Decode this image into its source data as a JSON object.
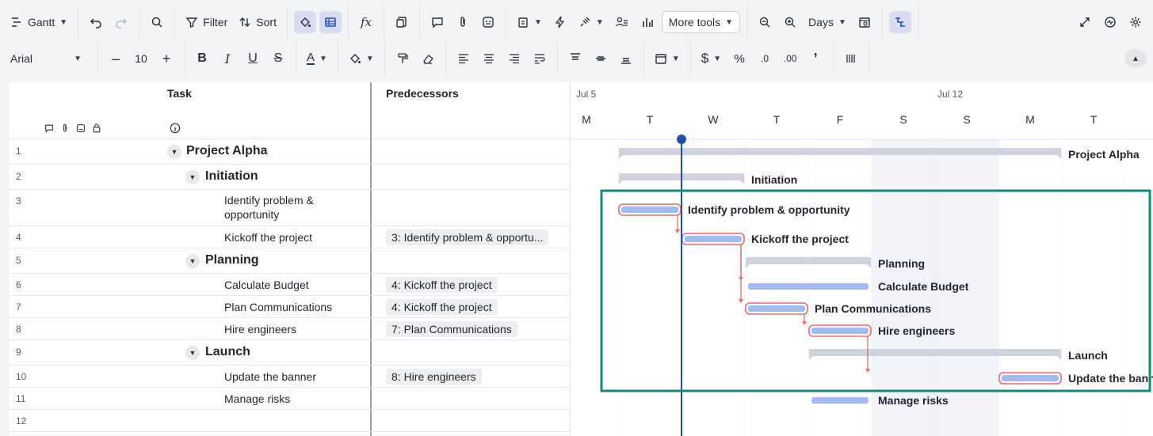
{
  "toolbar1": {
    "view_label": "Gantt",
    "filter_label": "Filter",
    "sort_label": "Sort",
    "more_tools_label": "More tools",
    "timescale_label": "Days"
  },
  "toolbar2": {
    "font_family": "Arial",
    "font_size": "10"
  },
  "columns": {
    "task": "Task",
    "predecessors": "Predecessors"
  },
  "rows": [
    {
      "num": "1",
      "name": "Project Alpha",
      "level": 0,
      "pred": ""
    },
    {
      "num": "2",
      "name": "Initiation",
      "level": 1,
      "pred": ""
    },
    {
      "num": "3",
      "name_line1": "Identify problem &",
      "name_line2": "opportunity",
      "level": 2,
      "pred": ""
    },
    {
      "num": "4",
      "name": "Kickoff the project",
      "level": 2,
      "pred": "3: Identify problem & opportu..."
    },
    {
      "num": "5",
      "name": "Planning",
      "level": 1,
      "pred": ""
    },
    {
      "num": "6",
      "name": "Calculate Budget",
      "level": 2,
      "pred": "4: Kickoff the project"
    },
    {
      "num": "7",
      "name": "Plan Communications",
      "level": 2,
      "pred": "4: Kickoff the project"
    },
    {
      "num": "8",
      "name": "Hire engineers",
      "level": 2,
      "pred": "7: Plan Communications"
    },
    {
      "num": "9",
      "name": "Launch",
      "level": 1,
      "pred": ""
    },
    {
      "num": "10",
      "name": "Update the banner",
      "level": 2,
      "pred": "8: Hire engineers"
    },
    {
      "num": "11",
      "name": "Manage risks",
      "level": 2,
      "pred": ""
    },
    {
      "num": "12",
      "name": "",
      "level": 2,
      "pred": ""
    }
  ],
  "timeline": {
    "week_labels": [
      "Jul 5",
      "Jul 12"
    ],
    "day_labels": [
      "M",
      "T",
      "W",
      "T",
      "F",
      "S",
      "S",
      "M",
      "T"
    ],
    "today_day_index": 1.5
  },
  "gantt_bars": [
    {
      "label": "Project Alpha",
      "type": "summary",
      "start_day": 0.5,
      "end_day": 7.5
    },
    {
      "label": "Initiation",
      "type": "summary",
      "start_day": 0.5,
      "end_day": 2.5
    },
    {
      "label": "Identify problem & opportunity",
      "type": "task-critical",
      "start_day": 0.5,
      "end_day": 1.5
    },
    {
      "label": "Kickoff the project",
      "type": "task-critical",
      "start_day": 1.5,
      "end_day": 2.5
    },
    {
      "label": "Planning",
      "type": "summary",
      "start_day": 2.5,
      "end_day": 4.5
    },
    {
      "label": "Calculate Budget",
      "type": "task",
      "start_day": 2.5,
      "end_day": 4.5
    },
    {
      "label": "Plan Communications",
      "type": "task-critical",
      "start_day": 2.5,
      "end_day": 3.5
    },
    {
      "label": "Hire engineers",
      "type": "task-critical",
      "start_day": 3.5,
      "end_day": 4.5
    },
    {
      "label": "Launch",
      "type": "summary",
      "start_day": 3.5,
      "end_day": 7.5
    },
    {
      "label": "Update the banner",
      "type": "task-critical",
      "start_day": 6.5,
      "end_day": 7.5
    },
    {
      "label": "Manage risks",
      "type": "task",
      "start_day": 3.5,
      "end_day": 4.5
    }
  ],
  "colors": {
    "summary_bar": "#cfd3de",
    "task_bar": "#a4b9f3",
    "critical_outline": "#e06c75",
    "today_line": "#1f4fb0",
    "highlight_box": "#128a78",
    "weekend_shade": "#f1f3f8"
  }
}
